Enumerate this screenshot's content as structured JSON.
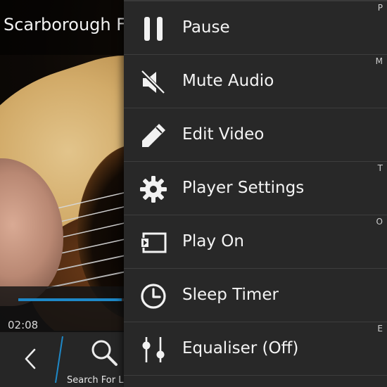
{
  "video": {
    "title": "Scarborough Fa",
    "current_time": "02:08",
    "progress_fraction": 0.28
  },
  "action_bar": {
    "back_icon": "chevron-left-icon",
    "search_label": "Search For L",
    "search_icon": "search-icon"
  },
  "menu": {
    "items": [
      {
        "label": "Pause",
        "shortcut": "P",
        "icon": "pause-icon"
      },
      {
        "label": "Mute Audio",
        "shortcut": "M",
        "icon": "mute-icon"
      },
      {
        "label": "Edit Video",
        "shortcut": "",
        "icon": "pencil-icon"
      },
      {
        "label": "Player Settings",
        "shortcut": "T",
        "icon": "gear-icon"
      },
      {
        "label": "Play On",
        "shortcut": "O",
        "icon": "cast-icon"
      },
      {
        "label": "Sleep Timer",
        "shortcut": "",
        "icon": "clock-icon"
      },
      {
        "label": "Equaliser (Off)",
        "shortcut": "E",
        "icon": "equaliser-icon"
      }
    ]
  },
  "colors": {
    "accent": "#1e88c7",
    "menu_background": "#282828",
    "action_bar": "#262626"
  }
}
